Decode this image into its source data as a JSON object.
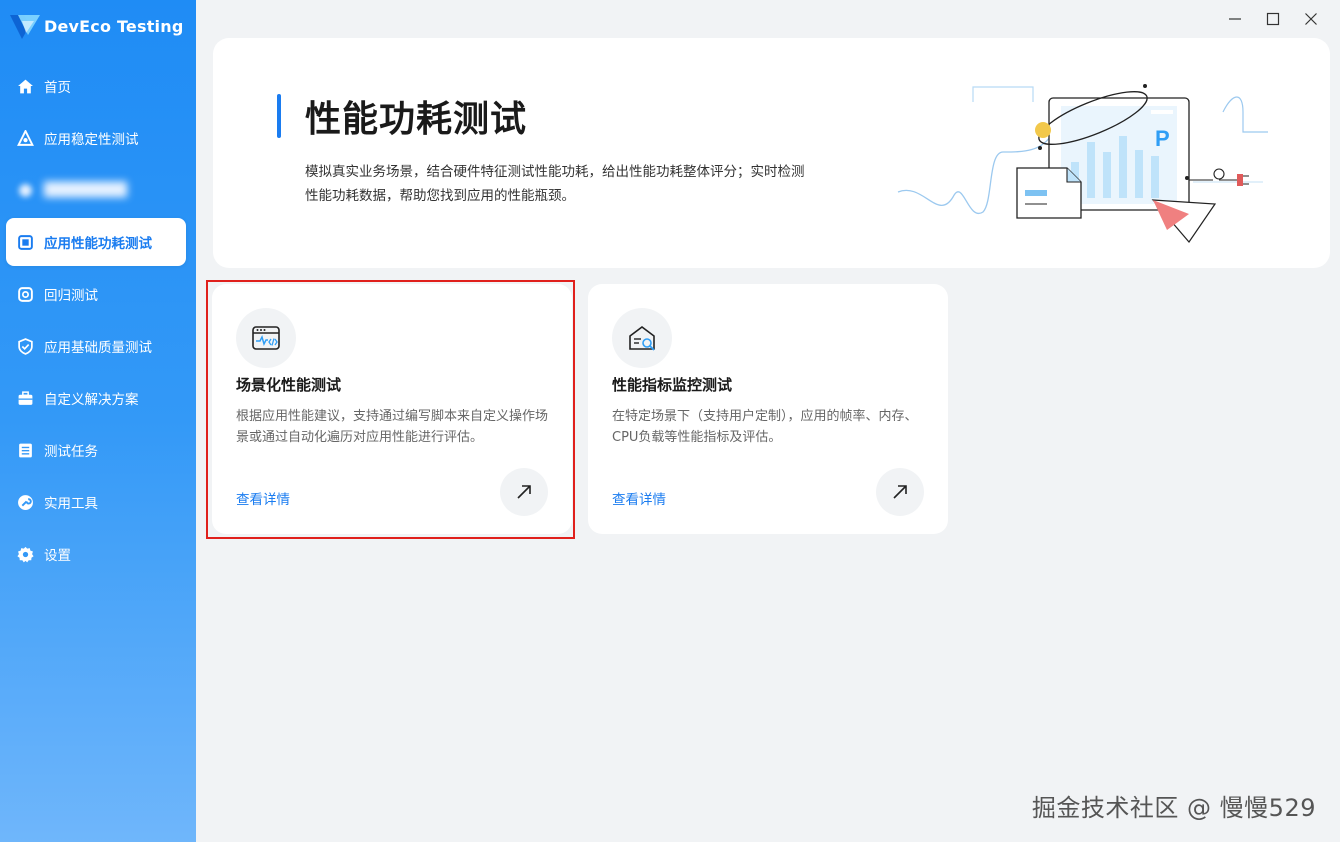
{
  "app": {
    "title": "DevEco Testing",
    "brand_color": "#1a7cf0"
  },
  "sidebar": {
    "items": [
      {
        "label": "首页",
        "icon": "home-icon"
      },
      {
        "label": "应用稳定性测试",
        "icon": "stability-icon"
      },
      {
        "label": "",
        "icon": "blurred-icon"
      },
      {
        "label": "应用性能功耗测试",
        "icon": "performance-icon",
        "active": true
      },
      {
        "label": "回归测试",
        "icon": "regression-icon"
      },
      {
        "label": "应用基础质量测试",
        "icon": "shield-check-icon"
      },
      {
        "label": "自定义解决方案",
        "icon": "toolbox-icon"
      },
      {
        "label": "测试任务",
        "icon": "list-icon"
      },
      {
        "label": "实用工具",
        "icon": "wrench-icon"
      },
      {
        "label": "设置",
        "icon": "gear-icon"
      }
    ]
  },
  "window": {
    "minimize": "minimize-icon",
    "maximize": "maximize-icon",
    "close": "close-icon"
  },
  "hero": {
    "title": "性能功耗测试",
    "description": "模拟真实业务场景，结合硬件特征测试性能功耗，给出性能功耗整体评分；实时检测性能功耗数据，帮助您找到应用的性能瓶颈。",
    "illustration_letter": "P"
  },
  "cards": [
    {
      "title": "场景化性能测试",
      "description": "根据应用性能建议，支持通过编写脚本来自定义操作场景或通过自动化遍历对应用性能进行评估。",
      "link": "查看详情",
      "icon": "code-window-icon"
    },
    {
      "title": "性能指标监控测试",
      "description": "在特定场景下（支持用户定制），应用的帧率、内存、CPU负载等性能指标及评估。",
      "link": "查看详情",
      "icon": "monitor-search-icon"
    }
  ],
  "watermark": "掘金技术社区 @ 慢慢529"
}
